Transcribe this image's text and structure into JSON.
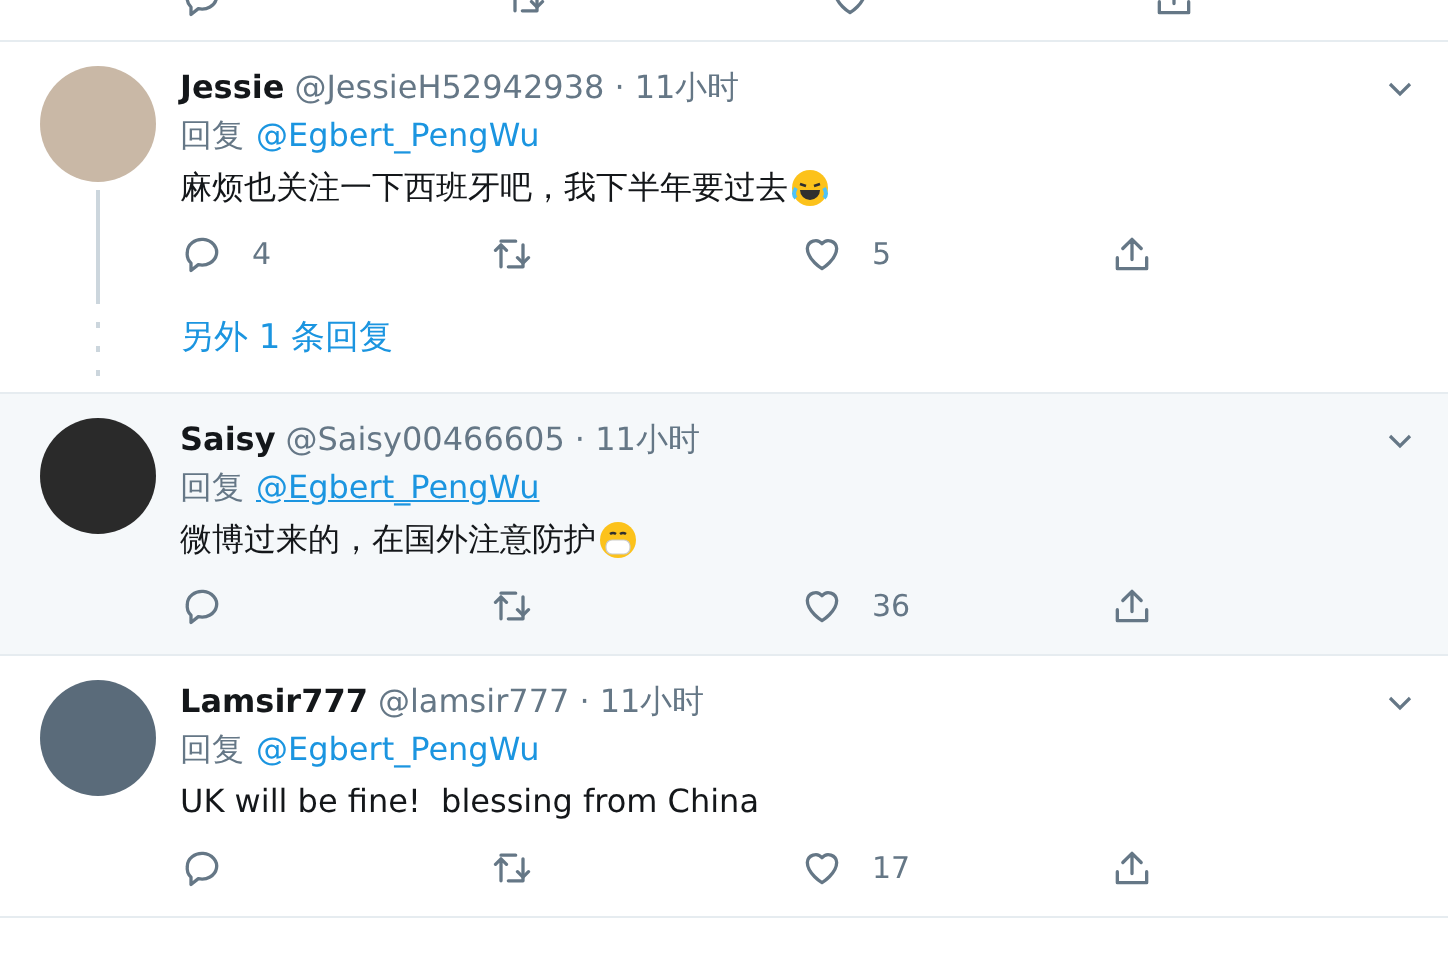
{
  "tweets": [
    {
      "name": "Jessie",
      "handle": "@JessieH52942938",
      "time": "· 11小时",
      "reply_prefix": "回复",
      "mention": "@Egbert_PengWu",
      "body": "麻烦也关注一下西班牙吧，我下半年要过去",
      "emoji": {
        "kind": "laughing"
      },
      "replies": "4",
      "likes": "5",
      "hovered": false,
      "more_replies": "另外 1 条回复"
    },
    {
      "name": "Saisy",
      "handle": "@Saisy00466605",
      "time": "· 11小时",
      "reply_prefix": "回复",
      "mention": "@Egbert_PengWu",
      "body": "微博过来的，在国外注意防护",
      "emoji": {
        "kind": "mask"
      },
      "likes": "36",
      "hovered": true
    },
    {
      "name": "Lamsir777",
      "handle": "@lamsir777",
      "time": "· 11小时",
      "reply_prefix": "回复",
      "mention": "@Egbert_PengWu",
      "body": "UK will be fine!  blessing from China",
      "likes": "17",
      "hovered": false
    }
  ]
}
